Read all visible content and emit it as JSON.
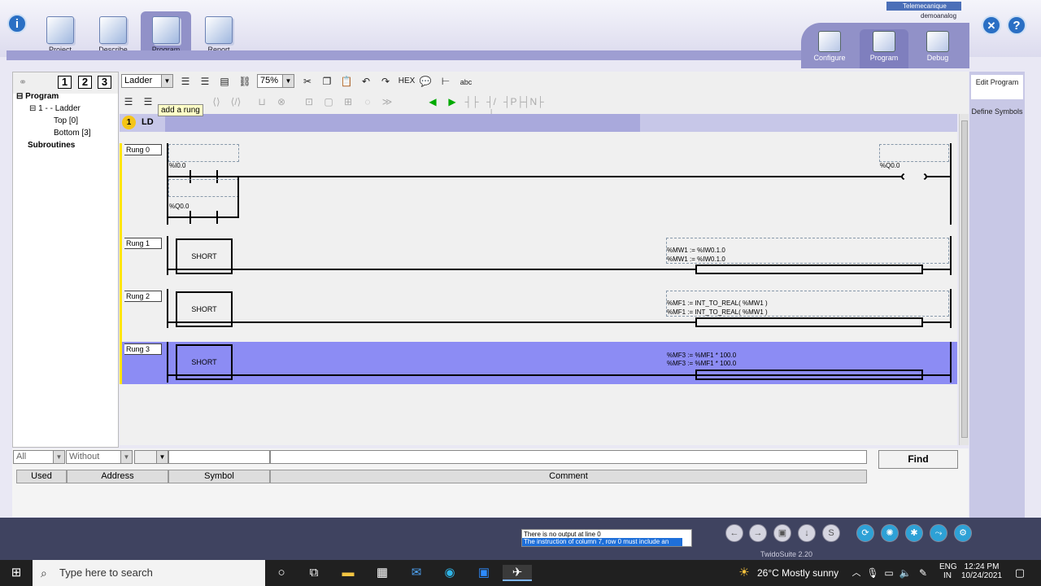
{
  "nav": {
    "project": "Project",
    "describe": "Describe",
    "program": "Program",
    "report": "Report"
  },
  "rightnav": {
    "configure": "Configure",
    "program": "Program",
    "debug": "Debug"
  },
  "brand": {
    "telemecanique": "Telemecanique",
    "file": "demoanalog"
  },
  "tree": {
    "btn1": "1",
    "btn2": "2",
    "btn3": "3",
    "program": "Program",
    "ladder": "1 -  - Ladder",
    "top": "Top [0]",
    "bottom": "Bottom [3]",
    "subroutines": "Subroutines"
  },
  "toolbar": {
    "view": "Ladder",
    "zoom": "75%",
    "hex": "HEX",
    "abc": "abc"
  },
  "tooltip": "add a rung",
  "section": {
    "num": "1",
    "label": "LD"
  },
  "rungs": {
    "r0": {
      "label": "Rung 0",
      "in1": "%I0.0",
      "in2": "%Q0.0",
      "out": "%Q0.0"
    },
    "r1": {
      "label": "Rung 1",
      "block": "SHORT",
      "op1": "%MW1  := %IW0.1.0",
      "op2": "%MW1  := %IW0.1.0"
    },
    "r2": {
      "label": "Rung 2",
      "block": "SHORT",
      "op1": "%MF1  := INT_TO_REAL( %MW1 )",
      "op2": "%MF1  := INT_TO_REAL( %MW1 )"
    },
    "r3": {
      "label": "Rung 3",
      "block": "SHORT",
      "op1": "%MF3  := %MF1 * 100.0",
      "op2": "%MF3  := %MF1 * 100.0"
    }
  },
  "side": {
    "edit": "Edit Program",
    "define": "Define Symbols"
  },
  "filter": {
    "all": "All",
    "without": "Without",
    "find": "Find",
    "used": "Used",
    "address": "Address",
    "symbol": "Symbol",
    "comment": "Comment"
  },
  "status": {
    "msg1": "There is no output at line 0",
    "msg2": "The instruction of column 7, row 0 must include an",
    "version": "TwidoSuite 2.20"
  },
  "taskbar": {
    "search": "Type here to search",
    "weather": "26°C  Mostly sunny",
    "lang1": "ENG",
    "lang2": "IN",
    "time": "12:24 PM",
    "date": "10/24/2021"
  }
}
